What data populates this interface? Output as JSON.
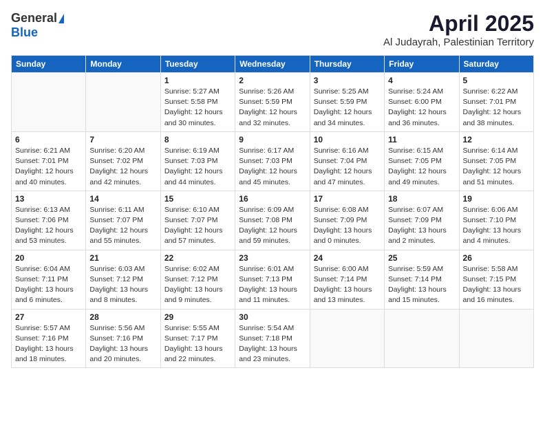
{
  "header": {
    "logo_general": "General",
    "logo_blue": "Blue",
    "month": "April 2025",
    "location": "Al Judayrah, Palestinian Territory"
  },
  "weekdays": [
    "Sunday",
    "Monday",
    "Tuesday",
    "Wednesday",
    "Thursday",
    "Friday",
    "Saturday"
  ],
  "weeks": [
    [
      {
        "day": "",
        "detail": ""
      },
      {
        "day": "",
        "detail": ""
      },
      {
        "day": "1",
        "detail": "Sunrise: 5:27 AM\nSunset: 5:58 PM\nDaylight: 12 hours\nand 30 minutes."
      },
      {
        "day": "2",
        "detail": "Sunrise: 5:26 AM\nSunset: 5:59 PM\nDaylight: 12 hours\nand 32 minutes."
      },
      {
        "day": "3",
        "detail": "Sunrise: 5:25 AM\nSunset: 5:59 PM\nDaylight: 12 hours\nand 34 minutes."
      },
      {
        "day": "4",
        "detail": "Sunrise: 5:24 AM\nSunset: 6:00 PM\nDaylight: 12 hours\nand 36 minutes."
      },
      {
        "day": "5",
        "detail": "Sunrise: 6:22 AM\nSunset: 7:01 PM\nDaylight: 12 hours\nand 38 minutes."
      }
    ],
    [
      {
        "day": "6",
        "detail": "Sunrise: 6:21 AM\nSunset: 7:01 PM\nDaylight: 12 hours\nand 40 minutes."
      },
      {
        "day": "7",
        "detail": "Sunrise: 6:20 AM\nSunset: 7:02 PM\nDaylight: 12 hours\nand 42 minutes."
      },
      {
        "day": "8",
        "detail": "Sunrise: 6:19 AM\nSunset: 7:03 PM\nDaylight: 12 hours\nand 44 minutes."
      },
      {
        "day": "9",
        "detail": "Sunrise: 6:17 AM\nSunset: 7:03 PM\nDaylight: 12 hours\nand 45 minutes."
      },
      {
        "day": "10",
        "detail": "Sunrise: 6:16 AM\nSunset: 7:04 PM\nDaylight: 12 hours\nand 47 minutes."
      },
      {
        "day": "11",
        "detail": "Sunrise: 6:15 AM\nSunset: 7:05 PM\nDaylight: 12 hours\nand 49 minutes."
      },
      {
        "day": "12",
        "detail": "Sunrise: 6:14 AM\nSunset: 7:05 PM\nDaylight: 12 hours\nand 51 minutes."
      }
    ],
    [
      {
        "day": "13",
        "detail": "Sunrise: 6:13 AM\nSunset: 7:06 PM\nDaylight: 12 hours\nand 53 minutes."
      },
      {
        "day": "14",
        "detail": "Sunrise: 6:11 AM\nSunset: 7:07 PM\nDaylight: 12 hours\nand 55 minutes."
      },
      {
        "day": "15",
        "detail": "Sunrise: 6:10 AM\nSunset: 7:07 PM\nDaylight: 12 hours\nand 57 minutes."
      },
      {
        "day": "16",
        "detail": "Sunrise: 6:09 AM\nSunset: 7:08 PM\nDaylight: 12 hours\nand 59 minutes."
      },
      {
        "day": "17",
        "detail": "Sunrise: 6:08 AM\nSunset: 7:09 PM\nDaylight: 13 hours\nand 0 minutes."
      },
      {
        "day": "18",
        "detail": "Sunrise: 6:07 AM\nSunset: 7:09 PM\nDaylight: 13 hours\nand 2 minutes."
      },
      {
        "day": "19",
        "detail": "Sunrise: 6:06 AM\nSunset: 7:10 PM\nDaylight: 13 hours\nand 4 minutes."
      }
    ],
    [
      {
        "day": "20",
        "detail": "Sunrise: 6:04 AM\nSunset: 7:11 PM\nDaylight: 13 hours\nand 6 minutes."
      },
      {
        "day": "21",
        "detail": "Sunrise: 6:03 AM\nSunset: 7:12 PM\nDaylight: 13 hours\nand 8 minutes."
      },
      {
        "day": "22",
        "detail": "Sunrise: 6:02 AM\nSunset: 7:12 PM\nDaylight: 13 hours\nand 9 minutes."
      },
      {
        "day": "23",
        "detail": "Sunrise: 6:01 AM\nSunset: 7:13 PM\nDaylight: 13 hours\nand 11 minutes."
      },
      {
        "day": "24",
        "detail": "Sunrise: 6:00 AM\nSunset: 7:14 PM\nDaylight: 13 hours\nand 13 minutes."
      },
      {
        "day": "25",
        "detail": "Sunrise: 5:59 AM\nSunset: 7:14 PM\nDaylight: 13 hours\nand 15 minutes."
      },
      {
        "day": "26",
        "detail": "Sunrise: 5:58 AM\nSunset: 7:15 PM\nDaylight: 13 hours\nand 16 minutes."
      }
    ],
    [
      {
        "day": "27",
        "detail": "Sunrise: 5:57 AM\nSunset: 7:16 PM\nDaylight: 13 hours\nand 18 minutes."
      },
      {
        "day": "28",
        "detail": "Sunrise: 5:56 AM\nSunset: 7:16 PM\nDaylight: 13 hours\nand 20 minutes."
      },
      {
        "day": "29",
        "detail": "Sunrise: 5:55 AM\nSunset: 7:17 PM\nDaylight: 13 hours\nand 22 minutes."
      },
      {
        "day": "30",
        "detail": "Sunrise: 5:54 AM\nSunset: 7:18 PM\nDaylight: 13 hours\nand 23 minutes."
      },
      {
        "day": "",
        "detail": ""
      },
      {
        "day": "",
        "detail": ""
      },
      {
        "day": "",
        "detail": ""
      }
    ]
  ]
}
